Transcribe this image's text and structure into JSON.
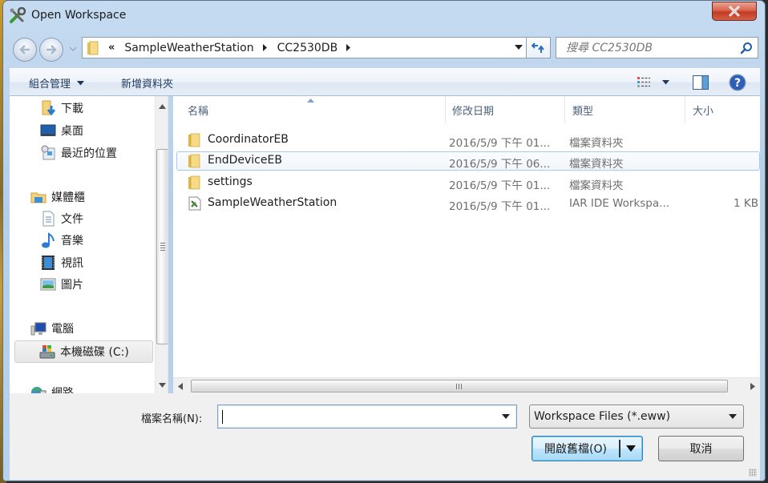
{
  "window": {
    "title": "Open Workspace",
    "close_icon": "close-icon"
  },
  "navigation": {
    "back_icon": "back-arrow-icon",
    "forward_icon": "forward-arrow-icon",
    "breadcrumb_overflow": "«",
    "breadcrumbs": [
      "SampleWeatherStation",
      "CC2530DB"
    ],
    "refresh_icon": "refresh-icon",
    "search_placeholder": "搜尋 CC2530DB"
  },
  "toolbar": {
    "organize_label": "組合管理",
    "new_folder_label": "新增資料夾",
    "view_icon": "view-options-icon",
    "preview_icon": "preview-pane-icon",
    "help_icon": "help-icon"
  },
  "sidebar": {
    "items": [
      {
        "label": "下載",
        "icon": "downloads-icon"
      },
      {
        "label": "桌面",
        "icon": "desktop-icon"
      },
      {
        "label": "最近的位置",
        "icon": "recent-places-icon"
      },
      {
        "label": "媒體櫃",
        "icon": "libraries-icon"
      },
      {
        "label": "文件",
        "icon": "documents-icon"
      },
      {
        "label": "音樂",
        "icon": "music-icon"
      },
      {
        "label": "視訊",
        "icon": "videos-icon"
      },
      {
        "label": "圖片",
        "icon": "pictures-icon"
      },
      {
        "label": "電腦",
        "icon": "computer-icon"
      },
      {
        "label": "本機磁碟 (C:)",
        "icon": "local-disk-icon",
        "selected": true
      },
      {
        "label": "網路",
        "icon": "network-icon"
      }
    ]
  },
  "file_list": {
    "columns": [
      "名稱",
      "修改日期",
      "類型",
      "大小"
    ],
    "sorted_by": "名稱",
    "rows": [
      {
        "name": "CoordinatorEB",
        "date": "2016/5/9 下午 01...",
        "type": "檔案資料夾",
        "size": "",
        "icon": "folder-icon"
      },
      {
        "name": "EndDeviceEB",
        "date": "2016/5/9 下午 06...",
        "type": "檔案資料夾",
        "size": "",
        "icon": "folder-icon",
        "hovered": true
      },
      {
        "name": "settings",
        "date": "2016/5/9 下午 01...",
        "type": "檔案資料夾",
        "size": "",
        "icon": "folder-icon"
      },
      {
        "name": "SampleWeatherStation",
        "date": "2016/5/9 下午 01...",
        "type": "IAR IDE Workspa...",
        "size": "1 KB",
        "icon": "workspace-file-icon"
      }
    ]
  },
  "footer": {
    "filename_label": "檔案名稱(N):",
    "filename_value": "",
    "filter_value": "Workspace Files (*.eww)",
    "open_label": "開啟舊檔(O)",
    "cancel_label": "取消"
  }
}
